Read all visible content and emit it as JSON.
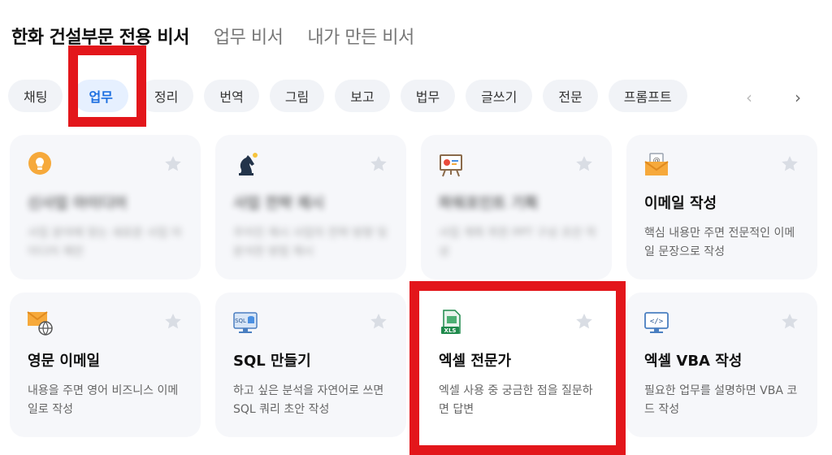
{
  "header": {
    "tabs": [
      "한화 건설부문 전용 비서",
      "업무 비서",
      "내가 만든 비서"
    ]
  },
  "chips": [
    "채팅",
    "업무",
    "정리",
    "번역",
    "그림",
    "보고",
    "법무",
    "글쓰기",
    "전문",
    "프롬프트"
  ],
  "nav": {
    "prev": "‹",
    "next": "›"
  },
  "cards": [
    {
      "icon": "lightbulb-icon",
      "title": "신사업 아이디어",
      "desc": "사업 분야에 맞는 새로운 사업 아이디어 제안"
    },
    {
      "icon": "chess-knight-icon",
      "title": "사업 전략 제시",
      "desc": "주어진 제시 사업의 전략 방향 및 분석한 방법 제시"
    },
    {
      "icon": "presentation-icon",
      "title": "파워포인트 기획",
      "desc": "사업 계획 위한 PPT 구성 초안 작성"
    },
    {
      "icon": "email-icon",
      "title": "이메일 작성",
      "desc": "핵심 내용만 주면 전문적인 이메일 문장으로 작성"
    },
    {
      "icon": "globe-mail-icon",
      "title": "영문 이메일",
      "desc": "내용을 주면 영어 비즈니스 이메일로 작성"
    },
    {
      "icon": "sql-icon",
      "title": "SQL 만들기",
      "desc": "하고 싶은 분석을 자연어로 쓰면 SQL 쿼리 초안 작성"
    },
    {
      "icon": "excel-icon",
      "title": "엑셀 전문가",
      "desc": "엑셀 사용 중 궁금한 점을 질문하면 답변"
    },
    {
      "icon": "code-monitor-icon",
      "title": "엑셀 VBA 작성",
      "desc": "필요한 업무를 설명하면 VBA 코드 작성"
    }
  ],
  "colors": {
    "accent": "#1d6fe0",
    "highlight": "#e3161b",
    "card_bg": "#f6f7fa",
    "chip_bg": "#f1f3f7"
  }
}
